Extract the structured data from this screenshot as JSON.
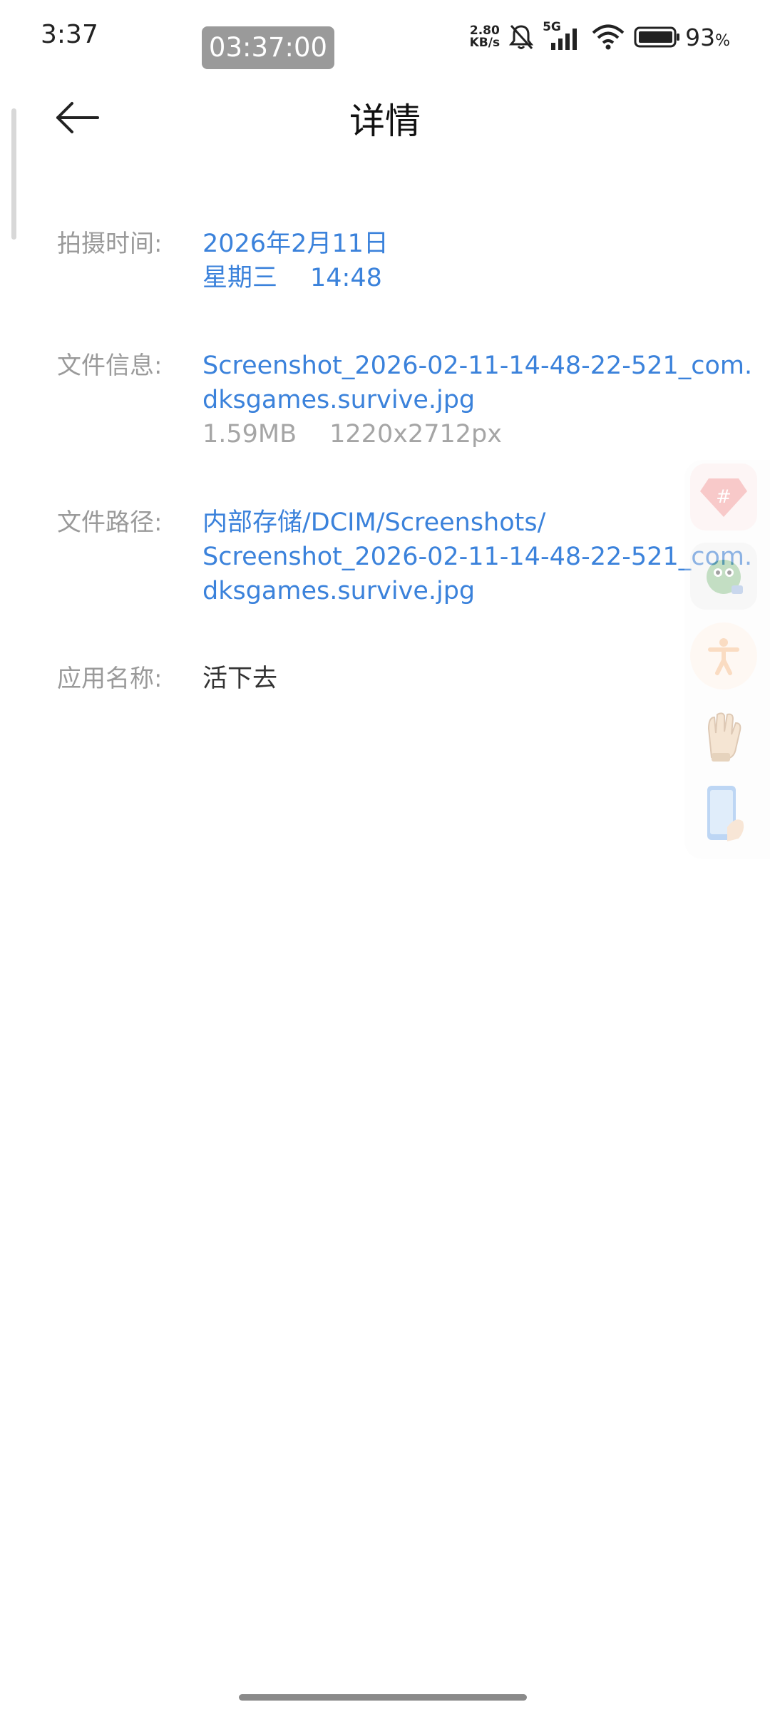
{
  "status_bar": {
    "time": "3:37",
    "recording_timer": "03:37:00",
    "net_speed_value": "2.80",
    "net_speed_unit": "KB/s",
    "network_type": "5G",
    "battery_percent": "93",
    "battery_unit": "%",
    "icons": [
      "bell-muted-icon",
      "signal-icon",
      "wifi-icon",
      "battery-icon"
    ]
  },
  "header": {
    "back_icon": "arrow-left-icon",
    "title": "详情"
  },
  "details": {
    "capture_time": {
      "label": "拍摄时间:",
      "date": "2026年2月11日",
      "weekday": "星期三",
      "time": "14:48"
    },
    "file_info": {
      "label": "文件信息:",
      "name_line1": "Screenshot_2026-02-11-14-48-22-521_com.",
      "name_line2": "dksgames.survive.jpg",
      "size": "1.59MB",
      "dimensions": "1220x2712px"
    },
    "file_path": {
      "label": "文件路径:",
      "line1": "内部存储/DCIM/Screenshots/",
      "line2": "Screenshot_2026-02-11-14-48-22-521_com.",
      "line3": "dksgames.survive.jpg"
    },
    "app_name": {
      "label": "应用名称:",
      "value": "活下去"
    }
  },
  "floating_dock": {
    "items": [
      "hashtag-app-icon",
      "game-app-icon",
      "accessibility-icon",
      "glove-app-icon",
      "phone-hand-icon"
    ]
  },
  "colors": {
    "link_blue": "#3b82db",
    "label_gray": "#9a9a9a",
    "meta_gray": "#a5a5a5"
  }
}
